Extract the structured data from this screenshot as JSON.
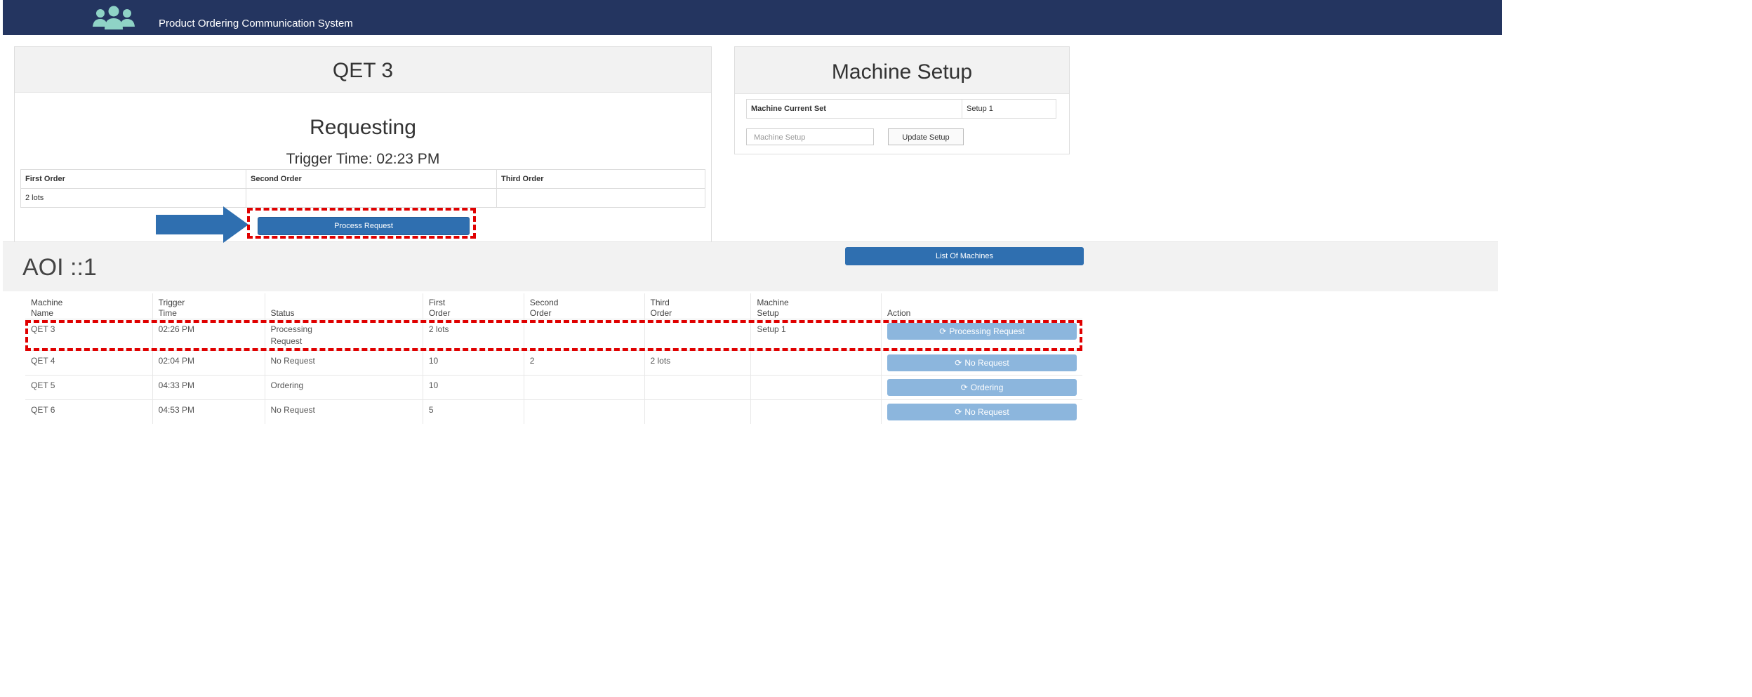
{
  "navbar": {
    "title": "Product Ordering Communication System",
    "logo_icon": "users-icon"
  },
  "qet_panel": {
    "title": "QET 3",
    "status": "Requesting",
    "trigger_time": "Trigger Time: 02:23 PM",
    "orders": {
      "headers": [
        "First Order",
        "Second Order",
        "Third Order"
      ],
      "values": [
        "2 lots",
        "",
        ""
      ]
    },
    "process_button": "Process Request"
  },
  "setup_panel": {
    "title": "Machine Setup",
    "current_label": "Machine Current Set",
    "current_value": "Setup 1",
    "input_placeholder": "Machine Setup",
    "update_button": "Update Setup"
  },
  "aoi": {
    "title": "AOI ::1",
    "list_button": "List Of Machines",
    "columns": [
      [
        "Machine",
        "Name"
      ],
      [
        "Trigger",
        "Time"
      ],
      [
        "Status",
        ""
      ],
      [
        "First",
        "Order"
      ],
      [
        "Second",
        "Order"
      ],
      [
        "Third",
        "Order"
      ],
      [
        "Machine",
        "Setup"
      ],
      [
        "Action",
        ""
      ]
    ],
    "rows": [
      {
        "machine": "QET 3",
        "time": "02:26 PM",
        "status": "Processing",
        "status2": "Request",
        "first": "2 lots",
        "second": "",
        "third": "",
        "setup": "Setup 1",
        "action": "Processing Request"
      },
      {
        "machine": "QET 4",
        "time": "02:04 PM",
        "status": "No Request",
        "status2": "",
        "first": "10",
        "second": "2",
        "third": "2 lots",
        "setup": "",
        "action": "No Request"
      },
      {
        "machine": "QET 5",
        "time": "04:33 PM",
        "status": "Ordering",
        "status2": "",
        "first": "10",
        "second": "",
        "third": "",
        "setup": "",
        "action": "Ordering"
      },
      {
        "machine": "QET 6",
        "time": "04:53 PM",
        "status": "No Request",
        "status2": "",
        "first": "5",
        "second": "",
        "third": "",
        "setup": "",
        "action": "No Request"
      }
    ]
  },
  "colors": {
    "navbar": "#243560",
    "primary_button": "#2f6fb0",
    "disabled_button": "#8cb6dd",
    "annotation": "#e00000",
    "arrow": "#2f6fb0"
  }
}
